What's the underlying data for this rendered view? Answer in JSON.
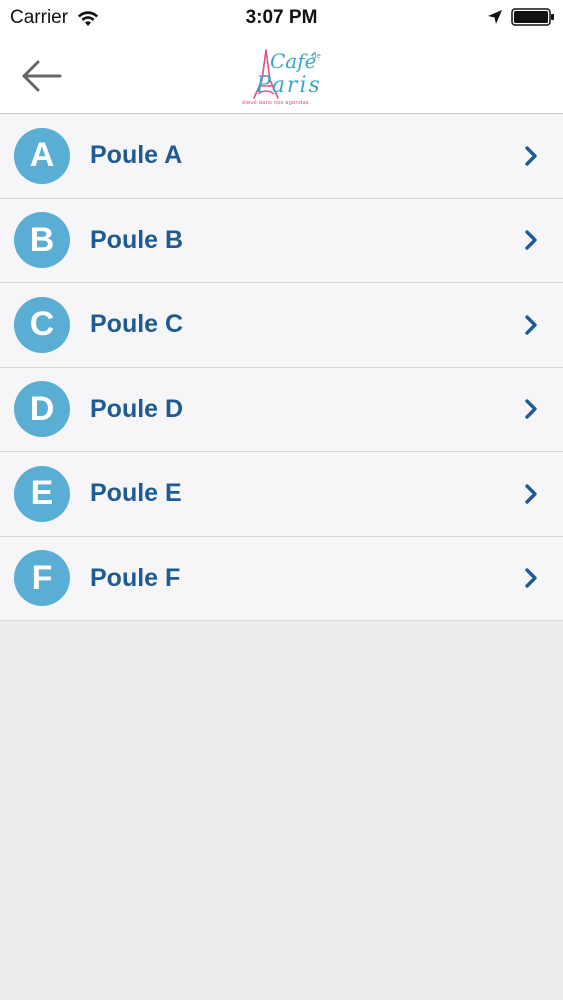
{
  "status_bar": {
    "carrier": "Carrier",
    "time": "3:07 PM",
    "icons": [
      "wifi-icon",
      "location-arrow-icon",
      "battery-icon"
    ]
  },
  "nav": {
    "back_icon": "arrow-left-icon",
    "logo": {
      "text_top": "Café",
      "text_de": "de",
      "text_main": "Paris",
      "tagline": "élevé dans nos agendas"
    }
  },
  "pools": [
    {
      "letter": "A",
      "label": "Poule A"
    },
    {
      "letter": "B",
      "label": "Poule B"
    },
    {
      "letter": "C",
      "label": "Poule C"
    },
    {
      "letter": "D",
      "label": "Poule D"
    },
    {
      "letter": "E",
      "label": "Poule E"
    },
    {
      "letter": "F",
      "label": "Poule F"
    }
  ],
  "colors": {
    "badge": "#5aaed3",
    "label": "#1f5a92",
    "row_bg": "#f6f6f8",
    "page_bg": "#ececee"
  }
}
